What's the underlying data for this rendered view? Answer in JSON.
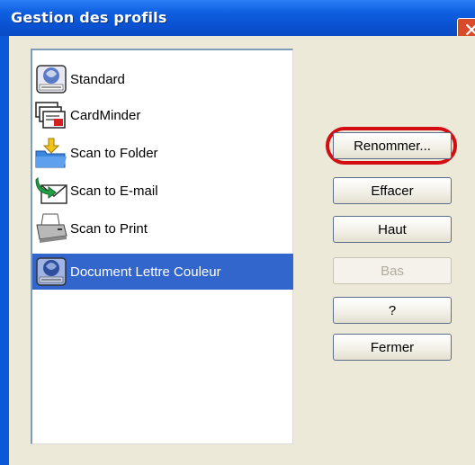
{
  "window": {
    "title": "Gestion des profils",
    "close_glyph": "✕"
  },
  "profiles": [
    {
      "label": "Standard",
      "icon": "scanner-organizer-icon"
    },
    {
      "label": "CardMinder",
      "icon": "cardminder-icon"
    },
    {
      "label": "Scan to Folder",
      "icon": "folder-scan-icon"
    },
    {
      "label": "Scan to E-mail",
      "icon": "email-scan-icon"
    },
    {
      "label": "Scan to Print",
      "icon": "printer-icon"
    },
    {
      "label": "Document Lettre Couleur",
      "icon": "scanner-organizer-icon",
      "selected": true
    }
  ],
  "buttons": {
    "rename": "Renommer...",
    "delete": "Effacer",
    "up": "Haut",
    "down": "Bas",
    "help": "?",
    "close": "Fermer"
  },
  "colors": {
    "titlebar": "#0a52d2",
    "selection": "#3366cc",
    "highlight_ring": "#d40d12"
  }
}
